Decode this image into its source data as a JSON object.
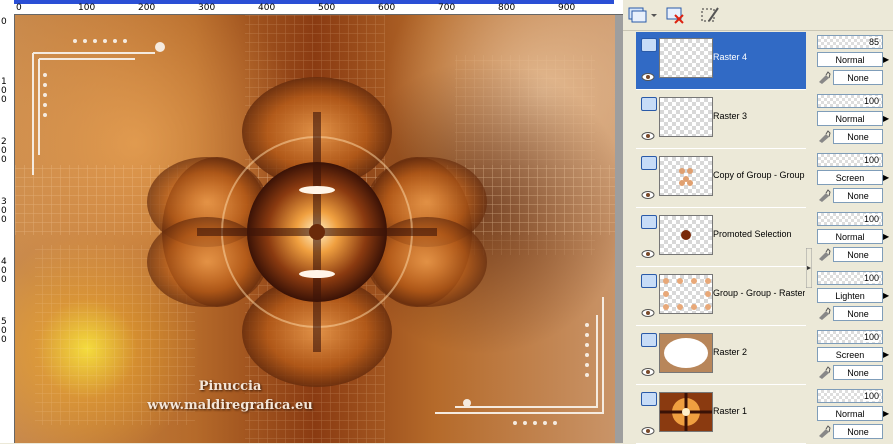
{
  "ruler": {
    "top_labels": [
      "0",
      "100",
      "200",
      "300",
      "400",
      "500",
      "600",
      "700",
      "800",
      "900"
    ],
    "left_labels": [
      "0",
      "1\n0\n0",
      "2\n0\n0",
      "3\n0\n0",
      "4\n0\n0",
      "5\n0\n0"
    ]
  },
  "image": {
    "credit_name": "Pinuccia",
    "credit_site": "www.maldiregrafica.eu"
  },
  "toolbar": {
    "new_layer_icon": "new-raster-layer-icon",
    "delete_icon": "delete-layer-icon",
    "edit_icon": "edit-selection-icon"
  },
  "layers": [
    {
      "name": "Raster 4",
      "opacity": "85",
      "blend": "Normal",
      "lock": "None",
      "selected": true,
      "thumb": "empty"
    },
    {
      "name": "Raster 3",
      "opacity": "100",
      "blend": "Normal",
      "lock": "None",
      "selected": false,
      "thumb": "empty"
    },
    {
      "name": "Copy of Group - Group",
      "opacity": "100",
      "blend": "Screen",
      "lock": "None",
      "selected": false,
      "thumb": "dots"
    },
    {
      "name": "Promoted Selection",
      "opacity": "100",
      "blend": "Normal",
      "lock": "None",
      "selected": false,
      "thumb": "point"
    },
    {
      "name": "Group - Group - Raster",
      "opacity": "100",
      "blend": "Lighten",
      "lock": "None",
      "selected": false,
      "thumb": "frame-dots"
    },
    {
      "name": "Raster 2",
      "opacity": "100",
      "blend": "Screen",
      "lock": "None",
      "selected": false,
      "thumb": "frame"
    },
    {
      "name": "Raster 1",
      "opacity": "100",
      "blend": "Normal",
      "lock": "None",
      "selected": false,
      "thumb": "full"
    }
  ],
  "colors": {
    "selection": "#316ac5",
    "panel_bg": "#ece9d8",
    "ruler_bar": "#2a4fd6"
  }
}
